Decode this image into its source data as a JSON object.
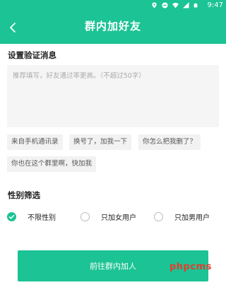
{
  "status_bar": {
    "time": "9:47",
    "icons": [
      "location-icon",
      "minus-circle-icon",
      "wifi-icon",
      "signal-icon",
      "battery-icon"
    ]
  },
  "header": {
    "title": "群内加好友",
    "back_icon": "chevron-left-icon"
  },
  "verify": {
    "heading": "设置验证消息",
    "placeholder": "推荐填写，好友通过率更高。（不超过50字）",
    "suggestions": [
      "来自手机通讯录",
      "换号了，加我一下",
      "你怎么把我删了？",
      "你也在这个群里啊，快加我"
    ]
  },
  "gender": {
    "heading": "性别筛选",
    "options": [
      {
        "label": "不限性别",
        "selected": true
      },
      {
        "label": "只加女用户",
        "selected": false
      },
      {
        "label": "只加男用户",
        "selected": false
      }
    ]
  },
  "submit_label": "前往群内加人",
  "watermark": "phpcms",
  "colors": {
    "accent": "#1cc394",
    "watermark": "#e63b2e"
  }
}
